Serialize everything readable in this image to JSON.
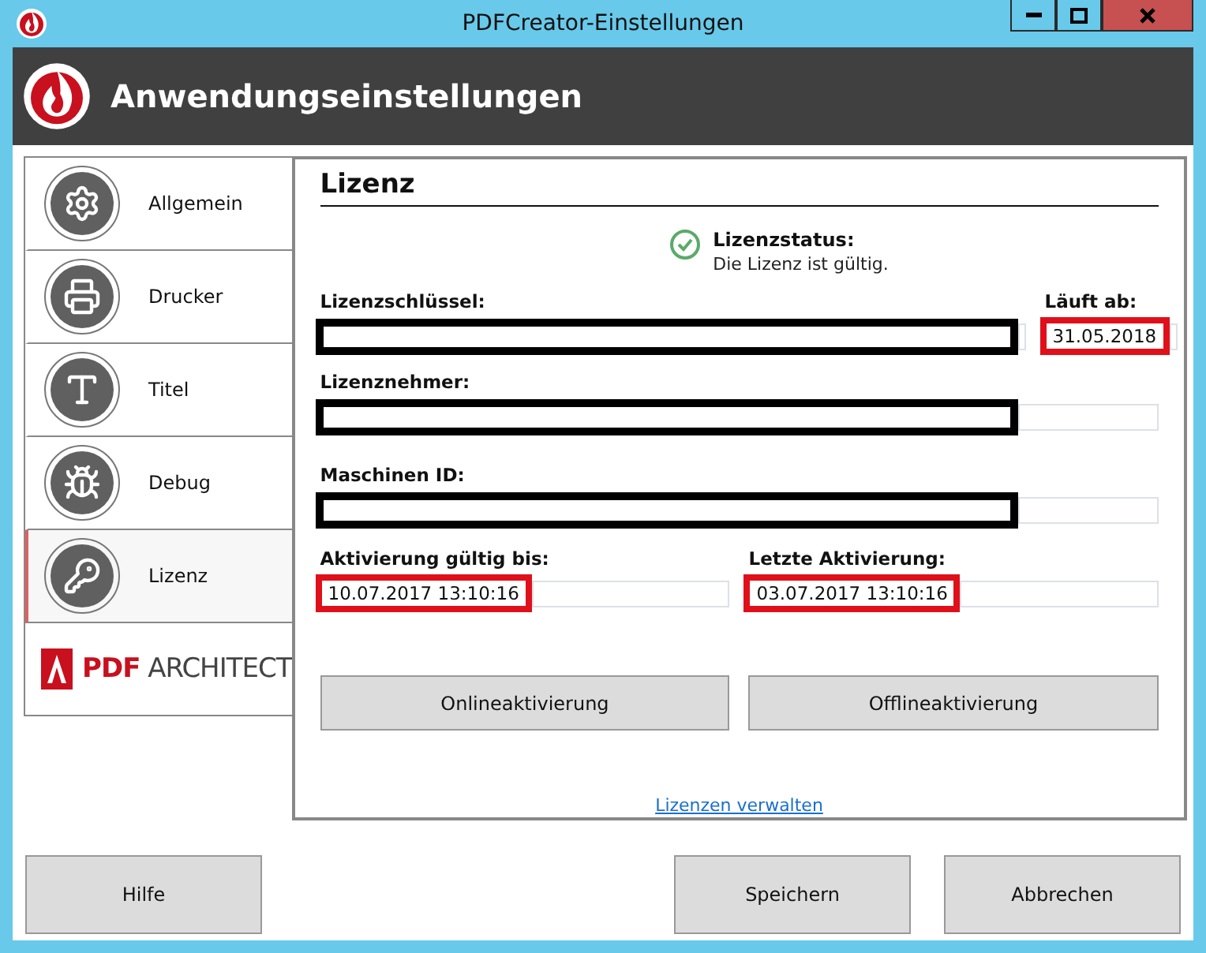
{
  "window": {
    "title": "PDFCreator-Einstellungen"
  },
  "header": {
    "title": "Anwendungseinstellungen"
  },
  "sidebar": {
    "items": [
      {
        "label": "Allgemein",
        "selected": false
      },
      {
        "label": "Drucker",
        "selected": false
      },
      {
        "label": "Titel",
        "selected": false
      },
      {
        "label": "Debug",
        "selected": false
      },
      {
        "label": "Lizenz",
        "selected": true
      }
    ],
    "brand": {
      "strong": "PDF",
      "rest": "ARCHITECT"
    }
  },
  "panel": {
    "title": "Lizenz",
    "status": {
      "label": "Lizenzstatus:",
      "message": "Die Lizenz ist gültig.",
      "valid": true
    },
    "license_key": {
      "label": "Lizenzschlüssel:",
      "redacted": true
    },
    "expires": {
      "label": "Läuft ab:",
      "value": "31.05.2018",
      "highlighted": true
    },
    "licensee": {
      "label": "Lizenznehmer:",
      "redacted": true
    },
    "machine_id": {
      "label": "Maschinen ID:",
      "redacted": true
    },
    "activation_valid_until": {
      "label": "Aktivierung gültig bis:",
      "value": "10.07.2017 13:10:16",
      "highlighted": true
    },
    "last_activation": {
      "label": "Letzte Aktivierung:",
      "value": "03.07.2017 13:10:16",
      "highlighted": true
    },
    "buttons": [
      "Onlineaktivierung",
      "Offlineaktivierung"
    ],
    "link": "Lizenzen verwalten"
  },
  "footer": {
    "help": "Hilfe",
    "buttons": [
      "Speichern",
      "Abbrechen"
    ]
  }
}
